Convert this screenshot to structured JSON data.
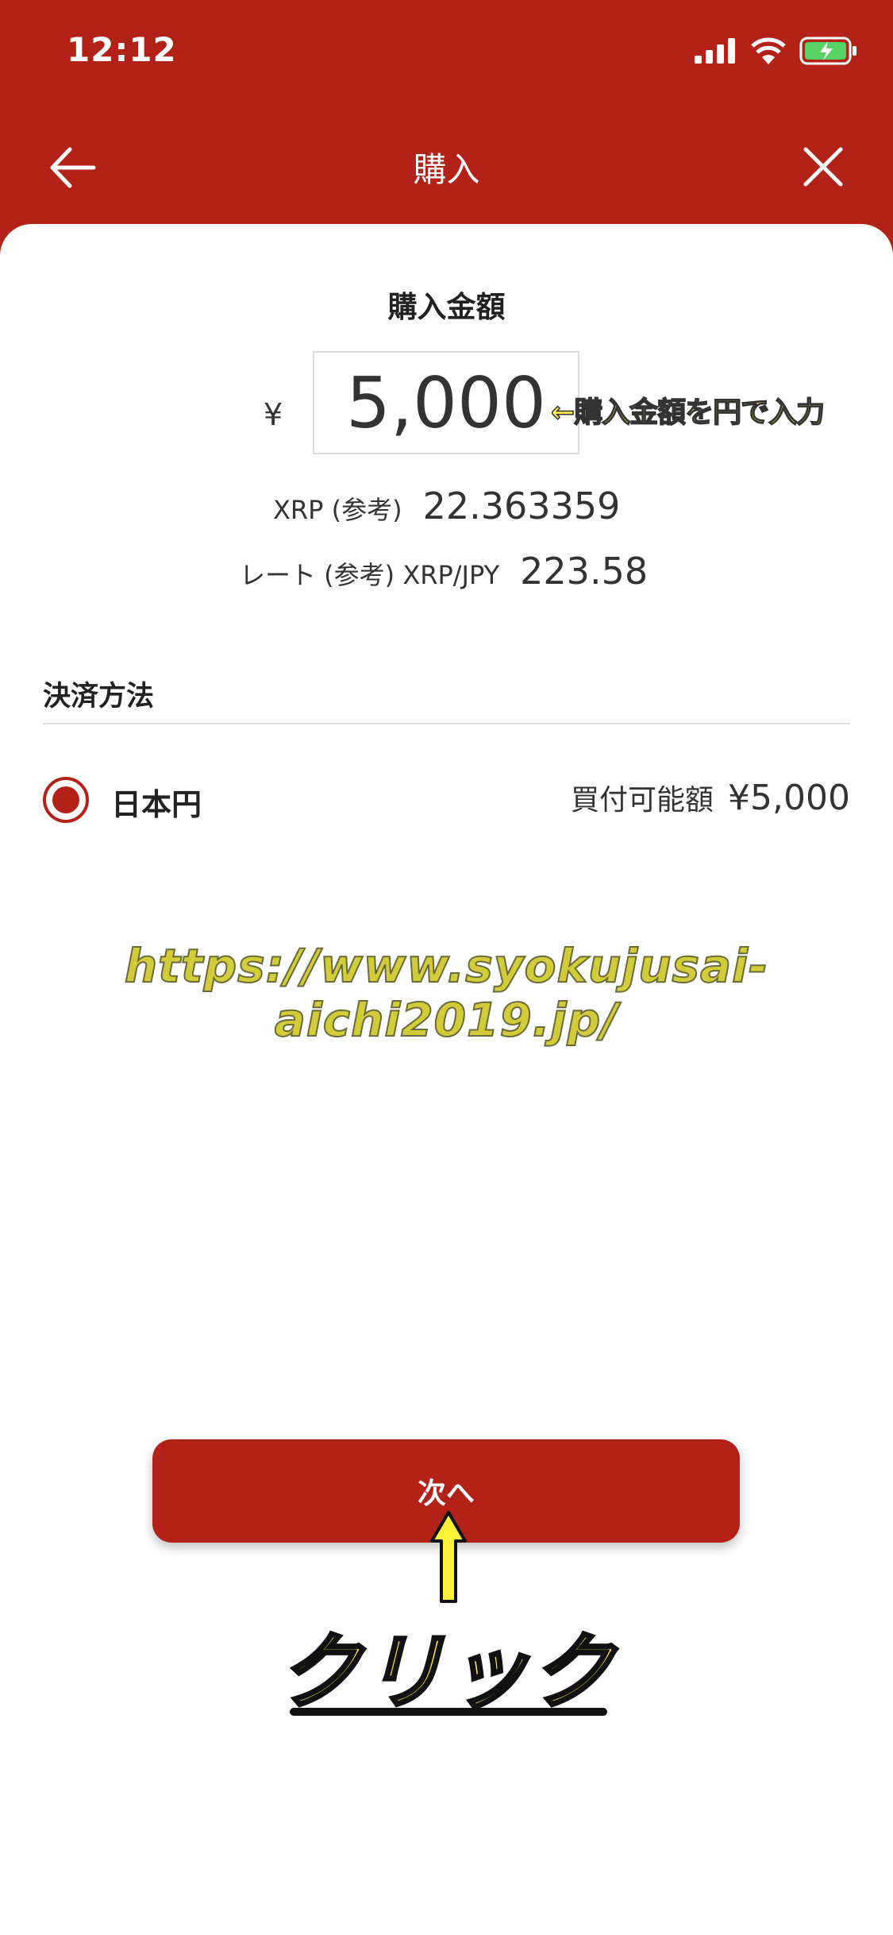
{
  "status_bar": {
    "time": "12:12"
  },
  "header": {
    "title": "購入"
  },
  "amount": {
    "title": "購入金額",
    "currency_symbol": "¥",
    "value": "5,000",
    "annotation": "←購入金額を円で入力"
  },
  "estimate": {
    "xrp_label": "XRP (参考)",
    "xrp_value": "22.363359",
    "rate_label": "レート (参考) XRP/JPY",
    "rate_value": "223.58"
  },
  "payment": {
    "title": "決済方法",
    "option_label": "日本円",
    "available_label": "買付可能額",
    "available_value": "¥5,000"
  },
  "watermark": "https://www.syokujusai-aichi2019.jp/",
  "next_button": {
    "label": "次へ"
  },
  "click_annotation": "クリック",
  "colors": {
    "brand_red": "#b22218",
    "annotation_yellow": "#fff23a"
  },
  "icons": [
    "cellular-signal-icon",
    "wifi-icon",
    "battery-charging-icon",
    "back-arrow-icon",
    "close-icon",
    "up-arrow-icon"
  ]
}
